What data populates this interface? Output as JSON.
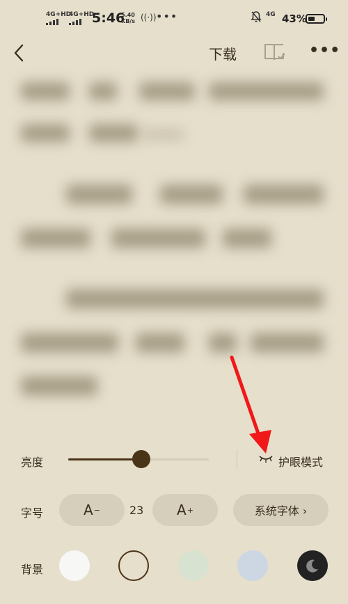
{
  "status_bar": {
    "sim1": "4G+HD",
    "sim2": "4G+HD",
    "time": "5:46",
    "speed_value": "5.40",
    "speed_unit": "KB/s",
    "more": "•••",
    "net": "4G",
    "battery": "43%",
    "battery_level": 0.43
  },
  "nav": {
    "download_label": "下载",
    "more_label": "•••"
  },
  "settings": {
    "brightness_label": "亮度",
    "brightness_value": 0.52,
    "eye_mode_label": "护眼模式",
    "font_size_label": "字号",
    "decrease_label": "A",
    "decrease_sup": "−",
    "font_size_value": "23",
    "increase_label": "A",
    "increase_sup": "+",
    "system_font_label": "系统字体 ›",
    "background_label": "背景",
    "background_options": [
      "#f7f7f5",
      "#e6dfcc",
      "#d7e3d0",
      "#cdd7e3",
      "#222222"
    ],
    "selected_background": 1
  }
}
